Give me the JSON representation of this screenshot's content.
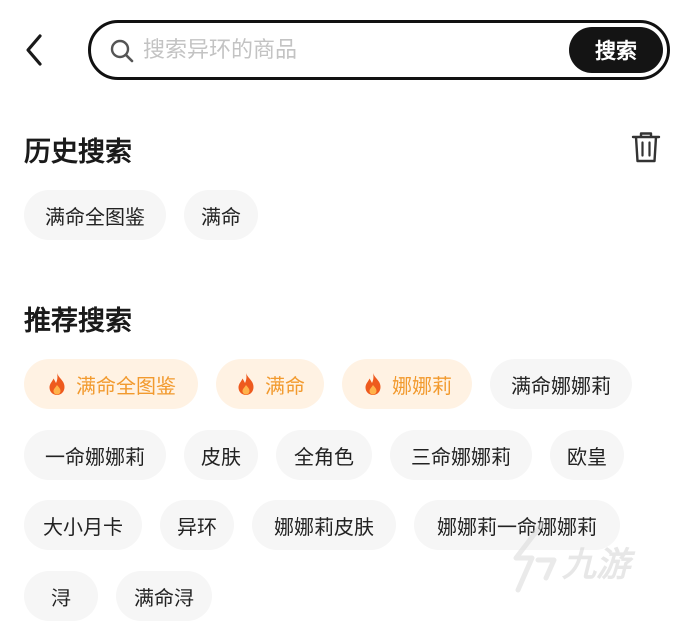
{
  "search": {
    "placeholder": "搜索异环的商品",
    "button_label": "搜索"
  },
  "history": {
    "title": "历史搜索",
    "items": [
      "满命全图鉴",
      "满命"
    ]
  },
  "recommend": {
    "title": "推荐搜索",
    "items": [
      {
        "label": "满命全图鉴",
        "hot": true
      },
      {
        "label": "满命",
        "hot": true
      },
      {
        "label": "娜娜莉",
        "hot": true
      },
      {
        "label": "满命娜娜莉",
        "hot": false
      },
      {
        "label": "一命娜娜莉",
        "hot": false
      },
      {
        "label": "皮肤",
        "hot": false
      },
      {
        "label": "全角色",
        "hot": false
      },
      {
        "label": "三命娜娜莉",
        "hot": false
      },
      {
        "label": "欧皇",
        "hot": false
      },
      {
        "label": "大小月卡",
        "hot": false
      },
      {
        "label": "异环",
        "hot": false
      },
      {
        "label": "娜娜莉皮肤",
        "hot": false
      },
      {
        "label": "娜娜莉一命娜娜莉",
        "hot": false
      },
      {
        "label": "浔",
        "hot": false
      },
      {
        "label": "满命浔",
        "hot": false
      }
    ]
  },
  "watermark": {
    "text": "九游"
  },
  "icons": {
    "back": "chevron-left-icon",
    "search": "search-icon",
    "trash": "trash-icon",
    "hot": "fire-icon"
  },
  "colors": {
    "accent_hot_text": "#f29a2e",
    "accent_hot_bg": "#fff2e3",
    "fire": "#ee5a1e",
    "button_bg": "#141414",
    "chip_bg": "#f6f6f6"
  }
}
